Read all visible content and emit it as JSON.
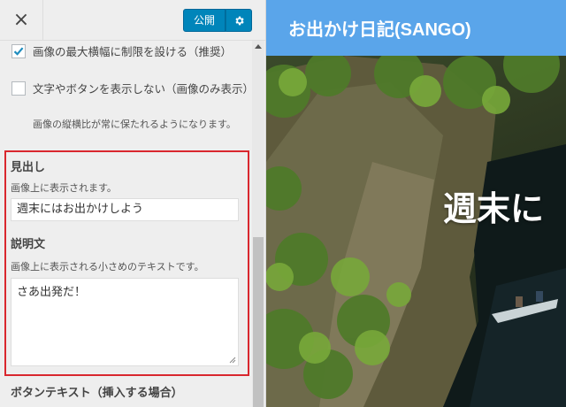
{
  "sidebar": {
    "close_label": "×",
    "publish_label": "公開",
    "gear_icon": "gear-icon",
    "options": [
      {
        "label": "画像の最大横幅に制限を設ける（推奨）",
        "checked": true
      },
      {
        "label": "文字やボタンを表示しない（画像のみ表示）",
        "checked": false
      }
    ],
    "option_note": "画像の縦横比が常に保たれるようになります。",
    "headline": {
      "title": "見出し",
      "description": "画像上に表示されます。",
      "value": "週末にはお出かけしよう"
    },
    "description_field": {
      "title": "説明文",
      "description": "画像上に表示される小さめのテキストです。",
      "value": "さあ出発だ！"
    },
    "button_text_title": "ボタンテキスト（挿入する場合）"
  },
  "preview": {
    "site_title": "お出かけ日記(SANGO)",
    "hero_heading": "週末に"
  },
  "colors": {
    "accent": "#0085ba",
    "highlight_border": "#d9272e",
    "header_bg": "#5aa5ea"
  }
}
